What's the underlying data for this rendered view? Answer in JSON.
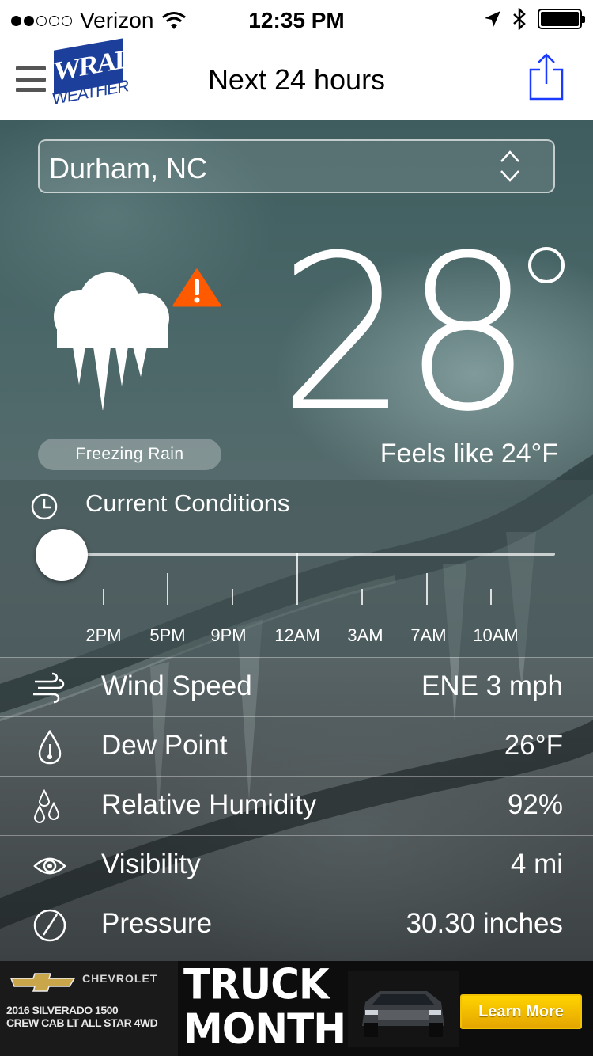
{
  "status_bar": {
    "carrier": "Verizon",
    "time": "12:35 PM",
    "signal_filled": 2,
    "signal_total": 5,
    "battery_level": 1.0
  },
  "nav": {
    "logo_text": "WRAL",
    "logo_subtext": "WEATHER",
    "title": "Next 24 hours"
  },
  "location": {
    "value": "Durham, NC"
  },
  "current": {
    "temperature": "28",
    "condition": "Freezing Rain",
    "feels_like": "Feels like  24°F",
    "alert_icon": "warning-icon",
    "condition_icon": "freezing-rain-icon"
  },
  "timeline": {
    "label": "Current Conditions",
    "slider_position": 0,
    "times": [
      "2PM",
      "5PM",
      "9PM",
      "12AM",
      "3AM",
      "7AM",
      "10AM"
    ]
  },
  "details": [
    {
      "icon": "wind-icon",
      "label": "Wind Speed",
      "value": "ENE 3 mph"
    },
    {
      "icon": "thermometer-drop-icon",
      "label": "Dew Point",
      "value": "26°F"
    },
    {
      "icon": "droplets-icon",
      "label": "Relative Humidity",
      "value": "92%"
    },
    {
      "icon": "eye-icon",
      "label": "Visibility",
      "value": "4 mi"
    },
    {
      "icon": "gauge-icon",
      "label": "Pressure",
      "value": "30.30 inches"
    }
  ],
  "ad": {
    "brand": "CHEVROLET",
    "subline_1": "2016 SILVERADO 1500",
    "subline_2": "CREW CAB LT ALL STAR 4WD",
    "headline_1": "TRUCK",
    "headline_2": "MONTH",
    "cta": "Learn More"
  },
  "colors": {
    "logo_blue": "#1d3f9c",
    "alert_orange": "#ff5a00",
    "cta_yellow": "#ffd400",
    "share_blue": "#1a3bff"
  }
}
